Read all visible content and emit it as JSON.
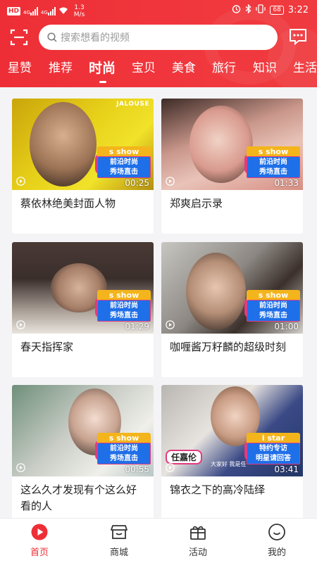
{
  "status_bar": {
    "hd": "HD",
    "net1": "4G",
    "net2": "4G",
    "speed_value": "1.3",
    "speed_unit": "M/s",
    "battery": "68",
    "time": "3:22"
  },
  "header": {
    "search_placeholder": "搜索想看的视频",
    "tabs": [
      "星赞",
      "推荐",
      "时尚",
      "宝贝",
      "美食",
      "旅行",
      "知识",
      "生活"
    ],
    "active_tab": 2
  },
  "cards": [
    {
      "title": "蔡依林绝美封面人物",
      "duration": "00:25",
      "badge_tag": "s show",
      "badge_line1": "前沿时尚",
      "badge_line2": "秀场直击",
      "watermark": "JALOUSE"
    },
    {
      "title": "郑爽启示录",
      "duration": "01:33",
      "badge_tag": "s show",
      "badge_line1": "前沿时尚",
      "badge_line2": "秀场直击"
    },
    {
      "title": "春天指挥家",
      "duration": "01:29",
      "badge_tag": "s show",
      "badge_line1": "前沿时尚",
      "badge_line2": "秀场直击"
    },
    {
      "title": "咖喱酱万籽麟的超级时刻",
      "duration": "01:00",
      "badge_tag": "s show",
      "badge_line1": "前沿时尚",
      "badge_line2": "秀场直击"
    },
    {
      "title": "这么久才发现有个这么好看的人",
      "duration": "00:55",
      "badge_tag": "s show",
      "badge_line1": "前沿时尚",
      "badge_line2": "秀场直击"
    },
    {
      "title": "锦衣之下的高冷陆绎",
      "duration": "03:41",
      "badge_tag": "i star",
      "badge_line1": "特约专访",
      "badge_line2": "明星请回答",
      "name_tag": "任嘉伦",
      "subtitle": "大家好 我是任"
    }
  ],
  "bottom_nav": [
    {
      "label": "首页",
      "icon": "home-play-icon"
    },
    {
      "label": "商城",
      "icon": "shop-icon"
    },
    {
      "label": "活动",
      "icon": "gift-icon"
    },
    {
      "label": "我的",
      "icon": "profile-icon"
    }
  ],
  "colors": {
    "brand_red": "#ee2e36",
    "badge_yellow": "#f3b51b",
    "badge_blue": "#1f6fe8",
    "badge_pink": "#e23a7f"
  }
}
